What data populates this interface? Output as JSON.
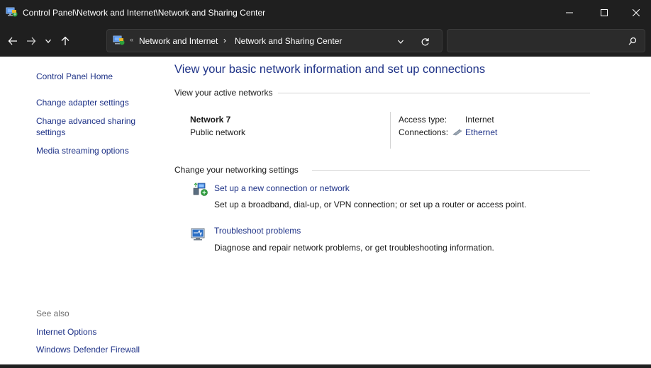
{
  "window": {
    "title": "Control Panel\\Network and Internet\\Network and Sharing Center"
  },
  "address": {
    "crumbs": [
      "Network and Internet",
      "Network and Sharing Center"
    ],
    "separator": "›",
    "search_placeholder": ""
  },
  "sidebar": {
    "home": "Control Panel Home",
    "links": [
      {
        "label": "Change adapter settings"
      },
      {
        "label": "Change advanced sharing"
      },
      {
        "label": "settings"
      },
      {
        "label": "Media streaming options"
      }
    ],
    "see_also_label": "See also",
    "see_also": [
      {
        "label": "Internet Options"
      },
      {
        "label": "Windows Defender Firewall"
      }
    ]
  },
  "main": {
    "heading": "View your basic network information and set up connections",
    "active_networks_label": "View your active networks",
    "network": {
      "name": "Network 7",
      "category": "Public network",
      "access_type_label": "Access type:",
      "access_type_value": "Internet",
      "connections_label": "Connections:",
      "connections_value": "Ethernet"
    },
    "change_settings_label": "Change your networking settings",
    "tasks": [
      {
        "title": "Set up a new connection or network",
        "description": "Set up a broadband, dial-up, or VPN connection; or set up a router or access point."
      },
      {
        "title": "Troubleshoot problems",
        "description": "Diagnose and repair network problems, or get troubleshooting information."
      }
    ]
  },
  "colors": {
    "titlebar": "#1f1f1f",
    "link": "#1e3287",
    "text": "#1a1a1a",
    "muted": "#6d6d6d",
    "divider": "#d4d4d4"
  },
  "icons": {
    "app": "network-center-icon",
    "back": "arrow-left-icon",
    "forward": "arrow-right-icon",
    "recent": "chevron-down-icon",
    "up": "arrow-up-icon",
    "refresh": "refresh-icon",
    "search": "search-icon",
    "ethernet": "ethernet-icon",
    "new_connection": "new-connection-icon",
    "troubleshoot": "troubleshoot-icon"
  }
}
